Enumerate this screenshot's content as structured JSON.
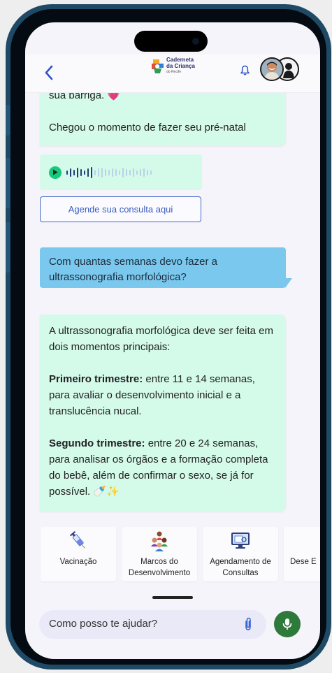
{
  "app": {
    "logo_lines": [
      "Caderneta",
      "da Criança"
    ],
    "logo_sub": "do Recife"
  },
  "header": {
    "back_icon": "chevron-left-icon",
    "notification_icon": "bell-icon"
  },
  "chat": {
    "bot_message_1": {
      "lines": [
        "sua barriga. 💗",
        "",
        "Chegou o momento de fazer seu pré-natal"
      ]
    },
    "audio_message": {
      "icon": "play-icon"
    },
    "schedule_button_label": "Agende sua consulta aqui",
    "user_message": "Com quantas semanas devo fazer a ultrassonografia morfológica?",
    "bot_message_2": {
      "intro": "A ultrassonografia morfológica deve ser feita em dois momentos principais:",
      "first_label": "Primeiro trimestre:",
      "first_text": " entre 11 e 14 semanas, para avaliar o desenvolvimento inicial e a translucência nucal.",
      "second_label": "Segundo trimestre:",
      "second_text": " entre 20 e 24 semanas, para analisar os órgãos e a formação completa do bebê, além de confirmar o sexo, se já for possível. ",
      "emoji": "🍼✨"
    }
  },
  "shortcuts": [
    {
      "label": "Vacinação",
      "icon": "syringe-icon"
    },
    {
      "label": "Marcos do Desenvolvimento",
      "icon": "children-group-icon"
    },
    {
      "label": "Agendamento de Consultas",
      "icon": "calendar-monitor-icon"
    },
    {
      "label": "Dese E",
      "icon": ""
    }
  ],
  "input": {
    "placeholder": "Como posso te ajudar?",
    "attach_icon": "paperclip-icon",
    "mic_icon": "microphone-icon"
  },
  "colors": {
    "bot_bubble": "#d4faea",
    "user_bubble": "#7ac8ee",
    "accent_blue": "#3f63c8",
    "mic_green": "#2e7a3a",
    "play_green": "#17c97e"
  }
}
